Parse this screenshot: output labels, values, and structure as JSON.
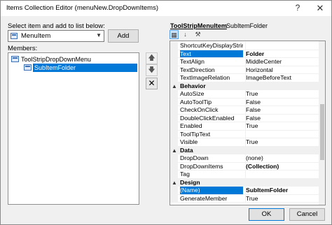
{
  "window": {
    "title": "Items Collection Editor (menuNew.DropDownItems)"
  },
  "left": {
    "select_label": "Select item and add to list below:",
    "combo_value": "MenuItem",
    "add_label": "Add",
    "members_label": "Members:",
    "tree": {
      "root": "ToolStripDropDownMenu",
      "child": "SubItemFolder"
    },
    "up_icon": "arrow-up-icon",
    "down_icon": "arrow-down-icon",
    "delete_glyph": "✕"
  },
  "propgrid": {
    "type_label": "ToolStripMenuItem",
    "name_label": "SubItemFolder",
    "rows": [
      {
        "kind": "prop",
        "name": "ShortcutKeyDisplayString",
        "value": ""
      },
      {
        "kind": "prop",
        "name": "Text",
        "value": "Folder",
        "selected": true,
        "bold": true
      },
      {
        "kind": "prop",
        "name": "TextAlign",
        "value": "MiddleCenter"
      },
      {
        "kind": "prop",
        "name": "TextDirection",
        "value": "Horizontal"
      },
      {
        "kind": "prop",
        "name": "TextImageRelation",
        "value": "ImageBeforeText"
      },
      {
        "kind": "cat",
        "name": "Behavior"
      },
      {
        "kind": "prop",
        "name": "AutoSize",
        "value": "True"
      },
      {
        "kind": "prop",
        "name": "AutoToolTip",
        "value": "False"
      },
      {
        "kind": "prop",
        "name": "CheckOnClick",
        "value": "False"
      },
      {
        "kind": "prop",
        "name": "DoubleClickEnabled",
        "value": "False"
      },
      {
        "kind": "prop",
        "name": "Enabled",
        "value": "True"
      },
      {
        "kind": "prop",
        "name": "ToolTipText",
        "value": ""
      },
      {
        "kind": "prop",
        "name": "Visible",
        "value": "True"
      },
      {
        "kind": "cat",
        "name": "Data"
      },
      {
        "kind": "prop",
        "name": "DropDown",
        "value": "(none)"
      },
      {
        "kind": "prop",
        "name": "DropDownItems",
        "value": "(Collection)",
        "bold": true
      },
      {
        "kind": "prop",
        "name": "Tag",
        "value": ""
      },
      {
        "kind": "cat",
        "name": "Design"
      },
      {
        "kind": "prop",
        "name": "(Name)",
        "value": "SubItemFolder",
        "selected": true,
        "bold": true
      },
      {
        "kind": "prop",
        "name": "GenerateMember",
        "value": "True"
      }
    ]
  },
  "buttons": {
    "ok": "OK",
    "cancel": "Cancel"
  },
  "icons": {
    "help": "?",
    "close": "✕",
    "categorized": "categorized-icon",
    "alphabetical": "alphabetical-icon",
    "property_pages": "wrench-icon"
  }
}
